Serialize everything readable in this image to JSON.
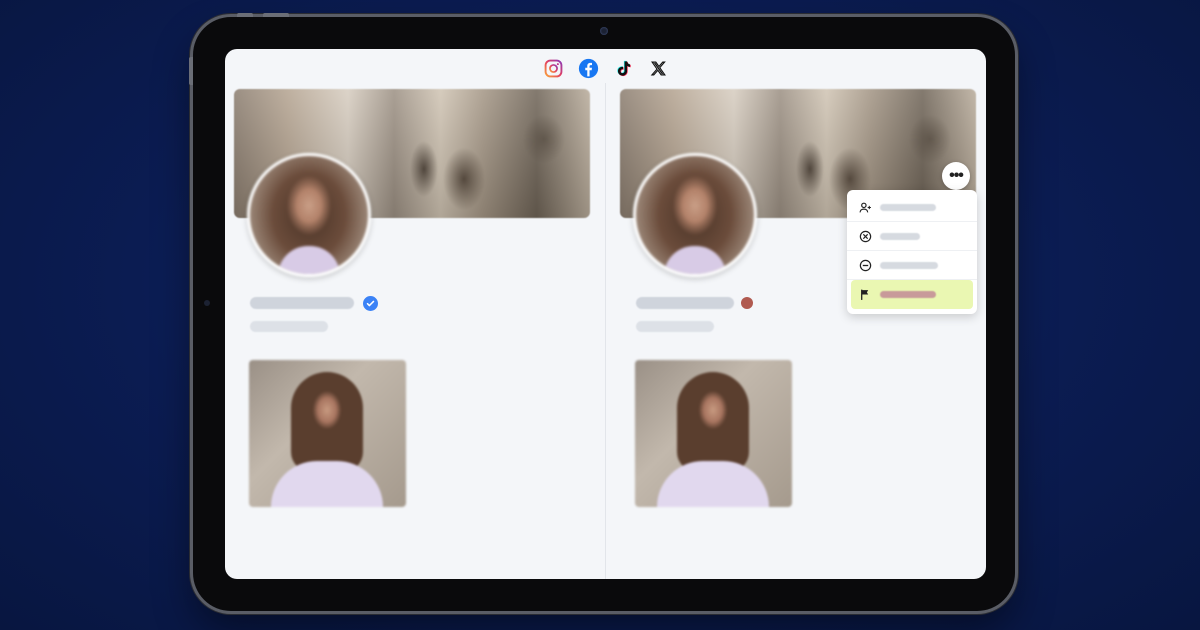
{
  "social_icons": [
    {
      "name": "instagram-icon",
      "color": "#e4405f"
    },
    {
      "name": "facebook-icon",
      "color": "#1877f2"
    },
    {
      "name": "tiktok-icon",
      "color": "#111111"
    },
    {
      "name": "x-icon",
      "color": "#111111"
    }
  ],
  "left_profile": {
    "verified_color": "#3b82f6"
  },
  "right_profile": {
    "status_dot_color": "#b05a50",
    "more_button_glyph": "•••",
    "menu": {
      "items": [
        {
          "icon": "user-add-icon"
        },
        {
          "icon": "x-circle-icon"
        },
        {
          "icon": "minus-circle-icon"
        },
        {
          "icon": "flag-icon",
          "highlighted": true,
          "highlight_color": "#eaf7b2"
        }
      ]
    }
  }
}
